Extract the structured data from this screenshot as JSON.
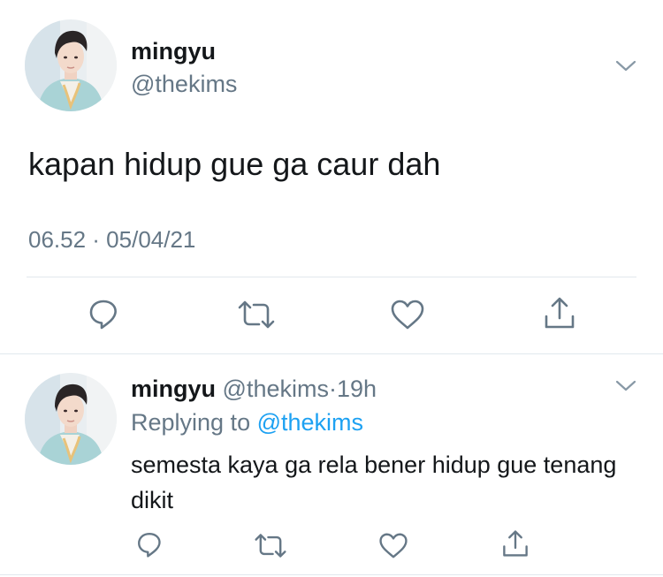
{
  "main_tweet": {
    "display_name": "mingyu",
    "handle": "@thekims",
    "text": "kapan hidup gue ga caur dah",
    "timestamp": "06.52 · 05/04/21",
    "actions": [
      "reply-icon",
      "retweet-icon",
      "like-icon",
      "share-icon"
    ]
  },
  "reply_tweet": {
    "display_name": "mingyu",
    "handle": "@thekims",
    "separator": "·",
    "relative_time": "19h",
    "replying_prefix": "Replying to",
    "replying_to": "@thekims",
    "text": "semesta kaya ga rela bener hidup gue tenang dikit",
    "actions": [
      "reply-icon",
      "retweet-icon",
      "like-icon",
      "share-icon"
    ]
  },
  "colors": {
    "text_primary": "#14171a",
    "text_secondary": "#657786",
    "link": "#1da1f2",
    "divider": "#e1e8ed"
  }
}
